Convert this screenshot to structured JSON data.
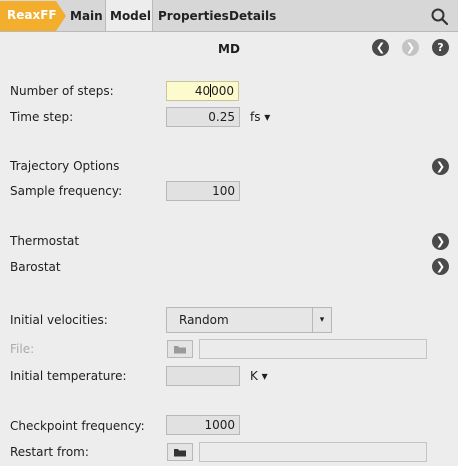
{
  "tabs": {
    "app": "ReaxFF",
    "items": [
      "Main",
      "Model",
      "Properties",
      "Details"
    ],
    "active": "Model"
  },
  "header": {
    "title": "MD"
  },
  "form": {
    "number_of_steps": {
      "label": "Number of steps:",
      "value_before_caret": "40",
      "value_after_caret": "000"
    },
    "time_step": {
      "label": "Time step:",
      "value": "0.25",
      "unit": "fs ▾"
    },
    "trajectory_options": {
      "label": "Trajectory Options"
    },
    "sample_frequency": {
      "label": "Sample frequency:",
      "value": "100"
    },
    "thermostat": {
      "label": "Thermostat"
    },
    "barostat": {
      "label": "Barostat"
    },
    "initial_velocities": {
      "label": "Initial velocities:",
      "value": "Random",
      "arrow": "▾"
    },
    "file": {
      "label": "File:",
      "value": ""
    },
    "initial_temperature": {
      "label": "Initial temperature:",
      "value": "",
      "unit": "K ▾"
    },
    "checkpoint_frequency": {
      "label": "Checkpoint frequency:",
      "value": "1000"
    },
    "restart_from": {
      "label": "Restart from:",
      "value": ""
    }
  },
  "icons": {
    "back": "❮",
    "forward": "❯",
    "help": "?",
    "expand": "❯"
  }
}
